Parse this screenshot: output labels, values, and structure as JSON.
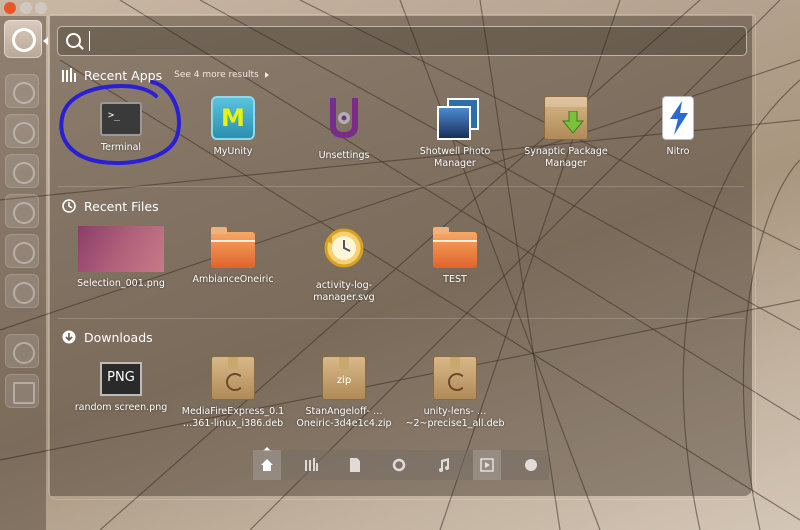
{
  "launcher": {
    "items": [
      "dash-home-icon",
      "workspace-icon",
      "app-icon-2",
      "app-icon-3",
      "app-icon-4",
      "app-icon-5",
      "app-icon-6",
      "app-icon-7",
      "app-icon-8"
    ]
  },
  "search": {
    "value": "",
    "placeholder": ""
  },
  "sections": {
    "recent_apps": {
      "title": "Recent Apps",
      "more": "See 4 more results",
      "items": [
        {
          "label": "Terminal",
          "icon": "terminal-icon"
        },
        {
          "label": "MyUnity",
          "icon": "myunity-icon"
        },
        {
          "label": "Unsettings",
          "icon": "unsettings-icon"
        },
        {
          "label": "Shotwell Photo Manager",
          "icon": "shotwell-icon"
        },
        {
          "label": "Synaptic Package Manager",
          "icon": "synaptic-icon"
        },
        {
          "label": "Nitro",
          "icon": "nitro-icon"
        }
      ]
    },
    "recent_files": {
      "title": "Recent Files",
      "items": [
        {
          "label": "Selection_001.png",
          "icon": "image-thumbnail"
        },
        {
          "label": "AmbianceOneiric",
          "icon": "folder-icon"
        },
        {
          "label": "activity-log-manager.svg",
          "icon": "activity-log-icon"
        },
        {
          "label": "TEST",
          "icon": "folder-icon"
        }
      ]
    },
    "downloads": {
      "title": "Downloads",
      "items": [
        {
          "label": "random screen.png",
          "icon": "png-icon"
        },
        {
          "label": "MediaFireExpress_0.1 …361-linux_i386.deb",
          "icon": "deb-icon"
        },
        {
          "label": "StanAngeloff- …Oneiric-3d4e1c4.zip",
          "icon": "zip-icon"
        },
        {
          "label": "unity-lens- …~2~precise1_all.deb",
          "icon": "deb-icon"
        }
      ]
    }
  },
  "lenses": [
    {
      "name": "home-lens-icon",
      "active": true
    },
    {
      "name": "applications-lens-icon",
      "active": false
    },
    {
      "name": "files-lens-icon",
      "active": false
    },
    {
      "name": "ubuntu-one-lens-icon",
      "active": false
    },
    {
      "name": "music-lens-icon",
      "active": false
    },
    {
      "name": "video-lens-icon",
      "active": true
    },
    {
      "name": "social-lens-icon",
      "active": false
    }
  ],
  "colors": {
    "annotation_circle": "#2a1fd6",
    "window_close": "#e8562a",
    "folder_orange": "#e0642a"
  }
}
